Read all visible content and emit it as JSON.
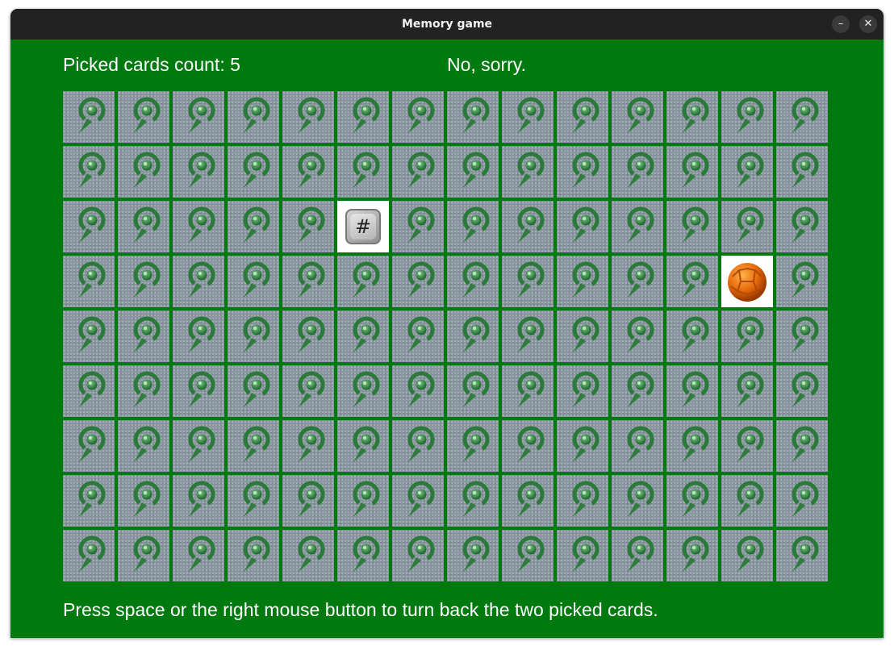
{
  "window": {
    "title": "Memory game",
    "minimize_label": "–",
    "close_label": "✕"
  },
  "status": {
    "picked_count_text": "Picked cards count: 5",
    "result_text": "No, sorry."
  },
  "instructions": "Press space or the right mouse button to turn back the two picked cards.",
  "board": {
    "columns": 14,
    "rows": 9,
    "card_back_icon": "green-spiral-pin-icon",
    "face_up_cards": [
      {
        "row": 2,
        "col": 5,
        "face": "hash-key-icon",
        "label": "#"
      },
      {
        "row": 3,
        "col": 12,
        "face": "orange-ball-icon"
      }
    ]
  },
  "colors": {
    "table_green": "#007a0f",
    "card_back_grey": "#8a96a0",
    "card_face_white": "#ffffff",
    "titlebar": "#222222"
  }
}
